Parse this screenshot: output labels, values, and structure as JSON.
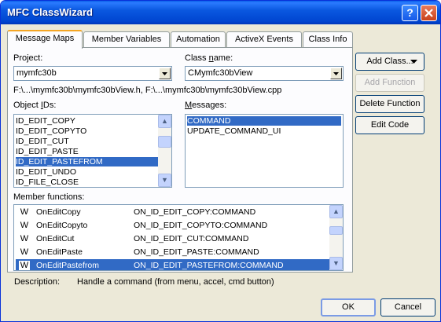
{
  "window": {
    "title": "MFC ClassWizard",
    "help_glyph": "?"
  },
  "tabs": [
    {
      "label": "Message Maps",
      "active": true
    },
    {
      "label": "Member Variables",
      "active": false
    },
    {
      "label": "Automation",
      "active": false
    },
    {
      "label": "ActiveX Events",
      "active": false
    },
    {
      "label": "Class Info",
      "active": false
    }
  ],
  "project": {
    "label": "Project:",
    "value": "mymfc30b"
  },
  "class_name": {
    "label_pre": "Class ",
    "label_u": "n",
    "label_post": "ame:",
    "value": "CMymfc30bView"
  },
  "files_path": "F:\\...\\mymfc30b\\mymfc30bView.h, F:\\...\\mymfc30b\\mymfc30bView.cpp",
  "object_ids": {
    "label_pre": "Object ",
    "label_u": "I",
    "label_post": "Ds:",
    "items": [
      "ID_EDIT_COPY",
      "ID_EDIT_COPYTO",
      "ID_EDIT_CUT",
      "ID_EDIT_PASTE",
      "ID_EDIT_PASTEFROM",
      "ID_EDIT_UNDO",
      "ID_FILE_CLOSE"
    ],
    "selected": "ID_EDIT_PASTEFROM"
  },
  "messages": {
    "label_pre": "",
    "label_u": "M",
    "label_post": "essages:",
    "items": [
      "COMMAND",
      "UPDATE_COMMAND_UI"
    ],
    "selected": "COMMAND"
  },
  "member_functions": {
    "label": "Member functions:",
    "glyph": "W",
    "rows": [
      {
        "name": "OnEditCopy",
        "map": "ON_ID_EDIT_COPY:COMMAND"
      },
      {
        "name": "OnEditCopyto",
        "map": "ON_ID_EDIT_COPYTO:COMMAND"
      },
      {
        "name": "OnEditCut",
        "map": "ON_ID_EDIT_CUT:COMMAND"
      },
      {
        "name": "OnEditPaste",
        "map": "ON_ID_EDIT_PASTE:COMMAND"
      },
      {
        "name": "OnEditPastefrom",
        "map": "ON_ID_EDIT_PASTEFROM:COMMAND"
      }
    ],
    "selected": "OnEditPastefrom"
  },
  "description": {
    "label": "Description:",
    "text": "Handle a command (from menu, accel, cmd button)"
  },
  "buttons": {
    "add_class": "Add Class...",
    "add_function": "Add Function",
    "delete_function": "Delete Function",
    "edit_code": "Edit Code",
    "ok": "OK",
    "cancel": "Cancel"
  },
  "icons": {
    "scroll_up": "▲",
    "scroll_down": "▼",
    "dropdown": "▼",
    "close": "close-icon",
    "help": "help-icon"
  },
  "colors": {
    "selection": "#316ac5",
    "titlebar": "#0a58e0",
    "dialog_bg": "#ece9d8"
  }
}
